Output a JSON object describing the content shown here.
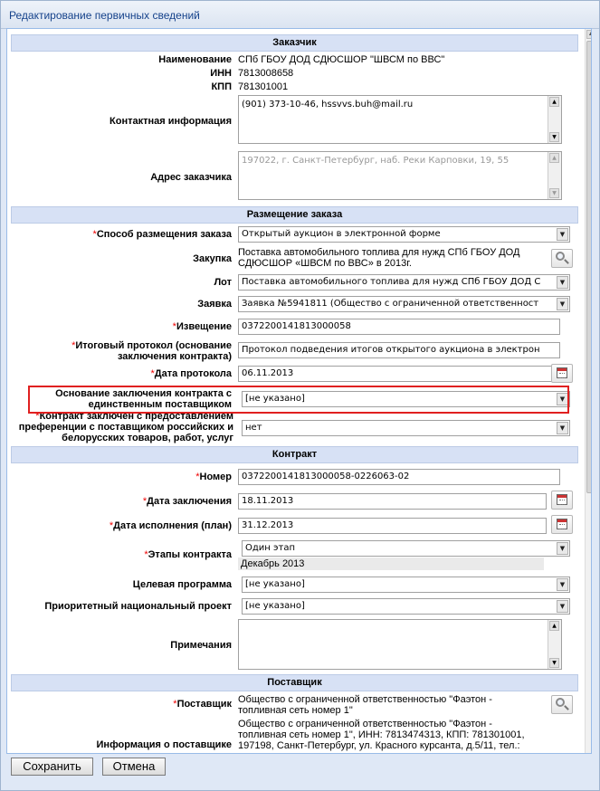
{
  "window": {
    "title": "Редактирование первичных сведений"
  },
  "customer": {
    "section_title": "Заказчик",
    "name_label": "Наименование",
    "name_value": "СПб ГБОУ ДОД СДЮСШОР \"ШВСМ по ВВС\"",
    "inn_label": "ИНН",
    "inn_value": "7813008658",
    "kpp_label": "КПП",
    "kpp_value": "781301001",
    "contact_label": "Контактная информация",
    "contact_value": "(901) 373-10-46, hssvvs.buh@mail.ru",
    "address_label": "Адрес заказчика",
    "address_value": "197022, г. Санкт-Петербург, наб. Реки Карповки, 19, 55"
  },
  "placement": {
    "section_title": "Размещение заказа",
    "method_label": "Способ размещения заказа",
    "method_value": "Открытый аукцион в электронной форме",
    "purchase_label": "Закупка",
    "purchase_value_line1": "Поставка автомобильного топлива для нужд СПб ГБОУ ДОД",
    "purchase_value_line2": "СДЮСШОР «ШВСМ по ВВС»  в 2013г.",
    "lot_label": "Лот",
    "lot_value": "Поставка автомобильного топлива для нужд СПб ГБОУ ДОД С",
    "application_label": "Заявка",
    "application_value": "Заявка №5941811 (Общество с ограниченной ответственност",
    "notice_label": "Извещение",
    "notice_value": "0372200141813000058",
    "protocol_label_line1": "Итоговый протокол (основание",
    "protocol_label_line2": "заключения контракта)",
    "protocol_value": "Протокол подведения итогов открытого аукциона в электрон",
    "protocol_date_label": "Дата протокола",
    "protocol_date_value": "06.11.2013",
    "basis_label_line1": "Основание заключения контракта с",
    "basis_label_line2": "единственным поставщиком",
    "basis_value": "[не указано]",
    "preference_label_line1": "Контракт заключен с предоставлением",
    "preference_label_line2": "преференции с поставщиком российских и",
    "preference_label_line3": "белорусских товаров, работ, услуг",
    "preference_value": "нет"
  },
  "contract": {
    "section_title": "Контракт",
    "number_label": "Номер",
    "number_value": "0372200141813000058-0226063-02",
    "sign_date_label": "Дата заключения",
    "sign_date_value": "18.11.2013",
    "exec_date_label": "Дата исполнения (план)",
    "exec_date_value": "31.12.2013",
    "stages_label": "Этапы контракта",
    "stages_value": "Один этап",
    "stages_period": "Декабрь 2013",
    "program_label": "Целевая программа",
    "program_value": "[не указано]",
    "project_label": "Приоритетный национальный проект",
    "project_value": "[не указано]",
    "notes_label": "Примечания",
    "notes_value": ""
  },
  "supplier": {
    "section_title": "Поставщик",
    "supplier_label": "Поставщик",
    "supplier_value_line1": "Общество с ограниченной ответственностью \"Фаэтон -",
    "supplier_value_line2": "топливная сеть номер 1\"",
    "info_label": "Информация о поставщике",
    "info_line1": "Общество с ограниченной ответственностью \"Фаэтон -",
    "info_line2": "топливная сеть номер 1\", ИНН: 7813474313, КПП: 781301001,",
    "info_line3": "197198, Санкт-Петербург, ул. Красного курсанта, д.5/11, тел.:"
  },
  "footer": {
    "save_label": "Сохранить",
    "cancel_label": "Отмена"
  },
  "required_mark": "*",
  "colors": {
    "highlight": "#e02020",
    "section_bg": "#d7e1f5",
    "title_text": "#15428b"
  }
}
